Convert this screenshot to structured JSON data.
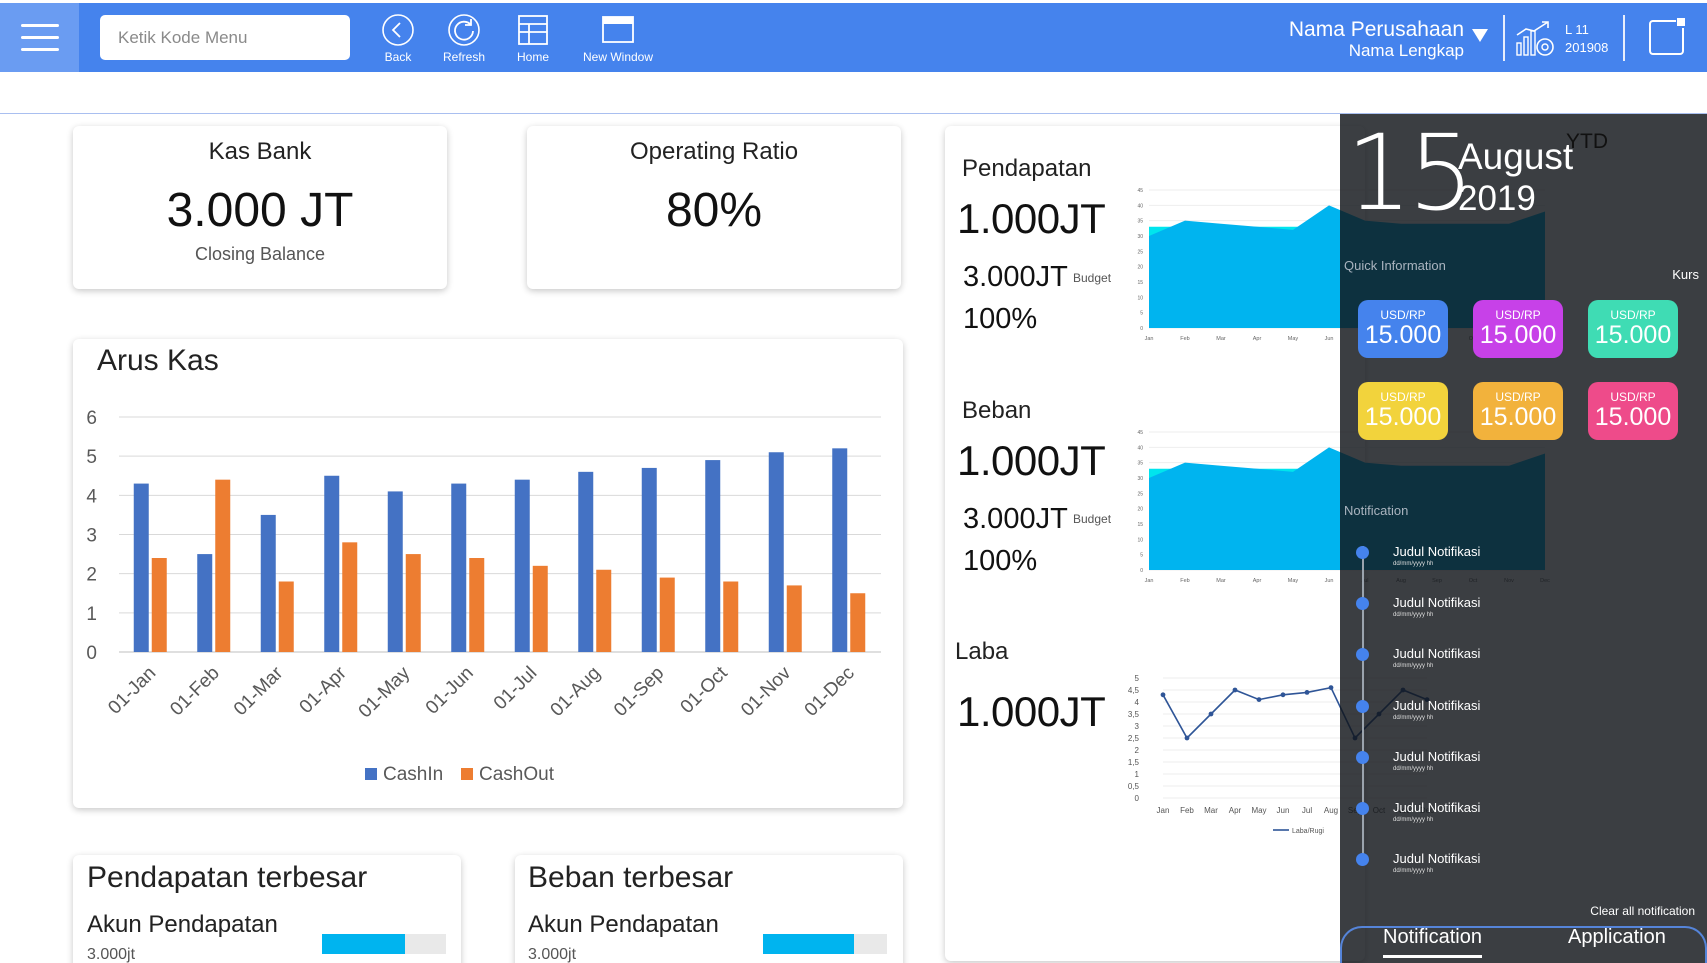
{
  "header": {
    "search_placeholder": "Ketik Kode Menu",
    "buttons": {
      "back": "Back",
      "refresh": "Refresh",
      "home": "Home",
      "new_window": "New Window"
    },
    "company_name": "Nama Perusahaan",
    "company_full": "Nama Lengkap",
    "level": "L 11",
    "period": "201908"
  },
  "kpis": {
    "kas_bank": {
      "title": "Kas Bank",
      "value": "3.000 JT",
      "sub": "Closing Balance"
    },
    "operating_ratio": {
      "title": "Operating Ratio",
      "value": "80%"
    }
  },
  "arus_kas": {
    "title": "Arus Kas",
    "chart_data": {
      "type": "bar",
      "title": "Arus Kas",
      "categories": [
        "01-Jan",
        "01-Feb",
        "01-Mar",
        "01-Apr",
        "01-May",
        "01-Jun",
        "01-Jul",
        "01-Aug",
        "01-Sep",
        "01-Oct",
        "01-Nov",
        "01-Dec"
      ],
      "series": [
        {
          "name": "CashIn",
          "color": "#4472c4",
          "values": [
            4.3,
            2.5,
            3.5,
            4.5,
            4.1,
            4.3,
            4.4,
            4.6,
            4.7,
            4.9,
            5.1,
            5.2
          ]
        },
        {
          "name": "CashOut",
          "color": "#ed7d31",
          "values": [
            2.4,
            4.4,
            1.8,
            2.8,
            2.5,
            2.4,
            2.2,
            2.1,
            1.9,
            1.8,
            1.7,
            1.5
          ]
        }
      ],
      "ylim": [
        0,
        6
      ],
      "yticks": [
        0,
        1,
        2,
        3,
        4,
        5,
        6
      ],
      "grid": true,
      "legend": "bottom"
    }
  },
  "pendapatan_terbesar": {
    "title": "Pendapatan terbesar",
    "account": "Akun Pendapatan",
    "value": "3.000jt",
    "fill": 0.67
  },
  "beban_terbesar": {
    "title": "Beban terbesar",
    "account": "Akun Pendapatan",
    "value": "3.000jt",
    "fill": 0.73
  },
  "sidebar_stats": {
    "pendapatan": {
      "label": "Pendapatan",
      "value": "1.000JT",
      "budget_value": "3.000JT",
      "budget_label": "Budget",
      "percent": "100%"
    },
    "beban": {
      "label": "Beban",
      "value": "1.000JT",
      "budget_value": "3.000JT",
      "budget_label": "Budget",
      "percent": "100%"
    },
    "laba": {
      "label": "Laba",
      "value": "1.000JT"
    }
  },
  "mini_area_chart": {
    "chart_data": {
      "type": "area",
      "categories": [
        "Jan",
        "Feb",
        "Mar",
        "Apr",
        "May",
        "Jun",
        "Jul",
        "Aug",
        "Sep",
        "Oct",
        "Nov",
        "Dec"
      ],
      "series": [
        {
          "color": "#00b4ef",
          "values": [
            30,
            35,
            34,
            33,
            32,
            40,
            35,
            34,
            34,
            34,
            34,
            38
          ]
        },
        {
          "color": "#00e5ee",
          "values": [
            33,
            33,
            33,
            33,
            33,
            33,
            33,
            33,
            33,
            33,
            33,
            33
          ]
        }
      ],
      "ylim": [
        0,
        45
      ],
      "yticks": [
        0,
        5,
        10,
        15,
        20,
        25,
        30,
        35,
        40,
        45
      ]
    }
  },
  "laba_chart": {
    "chart_data": {
      "type": "line",
      "categories": [
        "Jan",
        "Feb",
        "Mar",
        "Apr",
        "May",
        "Jun",
        "Jul",
        "Aug",
        "Sep",
        "Oct",
        "Nov",
        "Dec"
      ],
      "series": [
        {
          "name": "Laba/Rugi",
          "color": "#2f5597",
          "values": [
            4.3,
            2.5,
            3.5,
            4.5,
            4.1,
            4.3,
            4.4,
            4.6,
            2.5,
            3.5,
            4.5,
            4.1
          ]
        }
      ],
      "ylim": [
        0,
        5
      ],
      "yticks": [
        "0",
        "0,5",
        "1",
        "1,5",
        "2",
        "2,5",
        "3",
        "3,5",
        "4",
        "4,5",
        "5"
      ]
    }
  },
  "panel": {
    "day": "15",
    "month": "August",
    "year": "2019",
    "ytd": "YTD",
    "quick_info": "Quick Information",
    "kurs_label": "Kurs",
    "kurs": [
      {
        "label": "USD/RP",
        "value": "15.000",
        "color": "#4583ed"
      },
      {
        "label": "USD/RP",
        "value": "15.000",
        "color": "#c741e8"
      },
      {
        "label": "USD/RP",
        "value": "15.000",
        "color": "#3fdcb4"
      },
      {
        "label": "USD/RP",
        "value": "15.000",
        "color": "#f2d33c"
      },
      {
        "label": "USD/RP",
        "value": "15.000",
        "color": "#f2b23c"
      },
      {
        "label": "USD/RP",
        "value": "15.000",
        "color": "#ee4b8a"
      }
    ],
    "notification_label": "Notification",
    "notifications": [
      {
        "title": "Judul Notifikasi",
        "date": "dd/mm/yyyy hh"
      },
      {
        "title": "Judul Notifikasi",
        "date": "dd/mm/yyyy hh"
      },
      {
        "title": "Judul Notifikasi",
        "date": "dd/mm/yyyy hh"
      },
      {
        "title": "Judul Notifikasi",
        "date": "dd/mm/yyyy hh"
      },
      {
        "title": "Judul Notifikasi",
        "date": "dd/mm/yyyy hh"
      },
      {
        "title": "Judul Notifikasi",
        "date": "dd/mm/yyyy hh"
      },
      {
        "title": "Judul Notifikasi",
        "date": "dd/mm/yyyy hh"
      }
    ],
    "clear_all": "Clear all notification",
    "tabs": {
      "notification": "Notification",
      "application": "Application"
    }
  }
}
